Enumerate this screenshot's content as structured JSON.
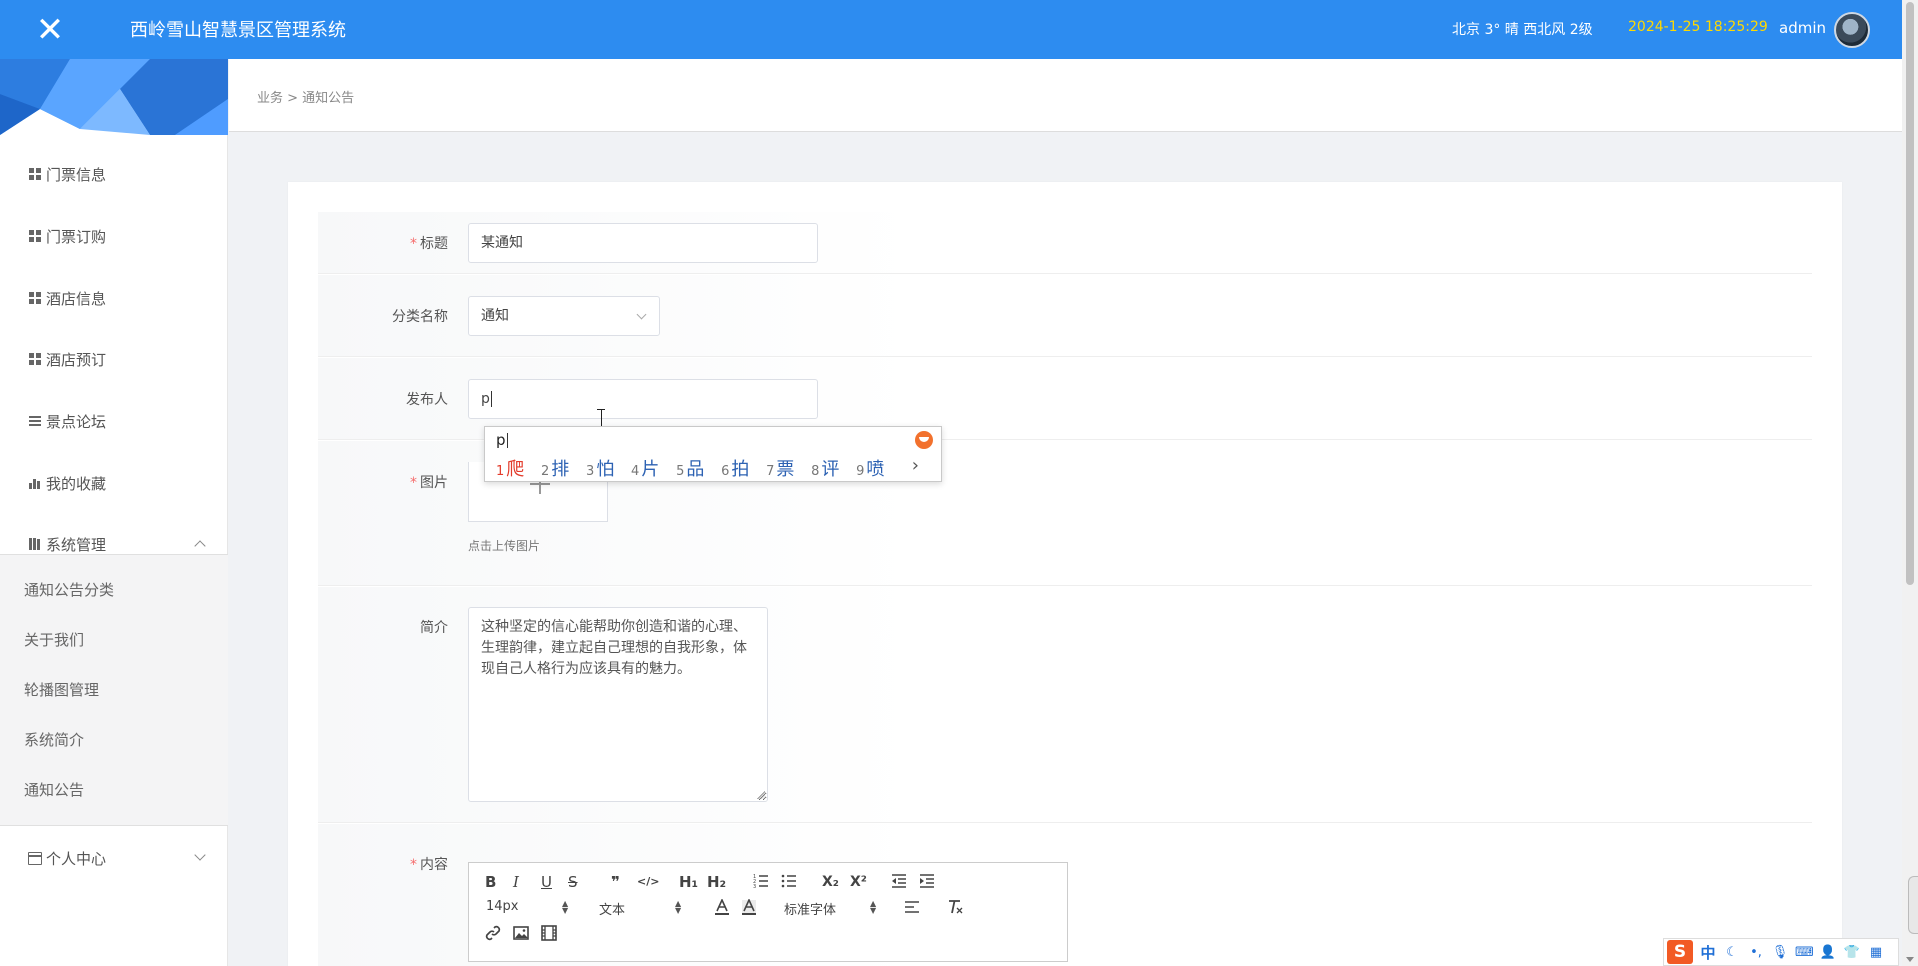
{
  "header": {
    "close_glyph": "✕",
    "title": "西岭雪山智慧景区管理系统",
    "weather": "北京  3°  晴  西北风  2级",
    "datetime": "2024-1-25 18:25:29",
    "user": "admin"
  },
  "sidebar": {
    "items": [
      {
        "label": "门票信息",
        "icon": "grid-icon"
      },
      {
        "label": "门票订购",
        "icon": "grid-icon"
      },
      {
        "label": "酒店信息",
        "icon": "grid-icon"
      },
      {
        "label": "酒店预订",
        "icon": "grid-icon"
      },
      {
        "label": "景点论坛",
        "icon": "list-icon"
      },
      {
        "label": "我的收藏",
        "icon": "bar-chart-icon"
      },
      {
        "label": "系统管理",
        "icon": "book-icon",
        "expanded": true
      },
      {
        "label": "个人中心",
        "icon": "card-icon",
        "expanded": false
      }
    ],
    "submenu": [
      "通知公告分类",
      "关于我们",
      "轮播图管理",
      "系统简介",
      "通知公告"
    ]
  },
  "breadcrumb": "业务 > 通知公告",
  "form": {
    "title": {
      "label": "标题",
      "required": true,
      "value": "某通知"
    },
    "category": {
      "label": "分类名称",
      "required": false,
      "value": "通知"
    },
    "publisher": {
      "label": "发布人",
      "required": false,
      "value": "p"
    },
    "image": {
      "label": "图片",
      "required": true,
      "hint": "点击上传图片"
    },
    "intro": {
      "label": "简介",
      "required": false,
      "value": "这种坚定的信心能帮助你创造和谐的心理、生理韵律，建立起自己理想的自我形象，体现自己人格行为应该具有的魅力。"
    },
    "content": {
      "label": "内容",
      "required": true
    }
  },
  "editor": {
    "buttons_row1": [
      "B",
      "I",
      "U",
      "S",
      "❞",
      "</>",
      "H₁",
      "H₂",
      "ordered-list-icon",
      "bullet-list-icon",
      "X₂",
      "X²",
      "outdent-icon",
      "indent-icon"
    ],
    "font_size": "14px",
    "text_style": "文本",
    "font_family": "标准字体",
    "buttons_row2": [
      "font-color-icon",
      "background-color-icon",
      "align-icon",
      "clear-format-icon"
    ],
    "buttons_row3": [
      "link-icon",
      "image-icon",
      "video-icon"
    ]
  },
  "ime": {
    "composition": "p",
    "candidates": [
      {
        "n": "1",
        "c": "爬"
      },
      {
        "n": "2",
        "c": "排"
      },
      {
        "n": "3",
        "c": "怕"
      },
      {
        "n": "4",
        "c": "片"
      },
      {
        "n": "5",
        "c": "品"
      },
      {
        "n": "6",
        "c": "拍"
      },
      {
        "n": "7",
        "c": "票"
      },
      {
        "n": "8",
        "c": "评"
      },
      {
        "n": "9",
        "c": "喷"
      }
    ],
    "more": "›",
    "statusbar": {
      "logo": "S",
      "mode": "中"
    }
  }
}
